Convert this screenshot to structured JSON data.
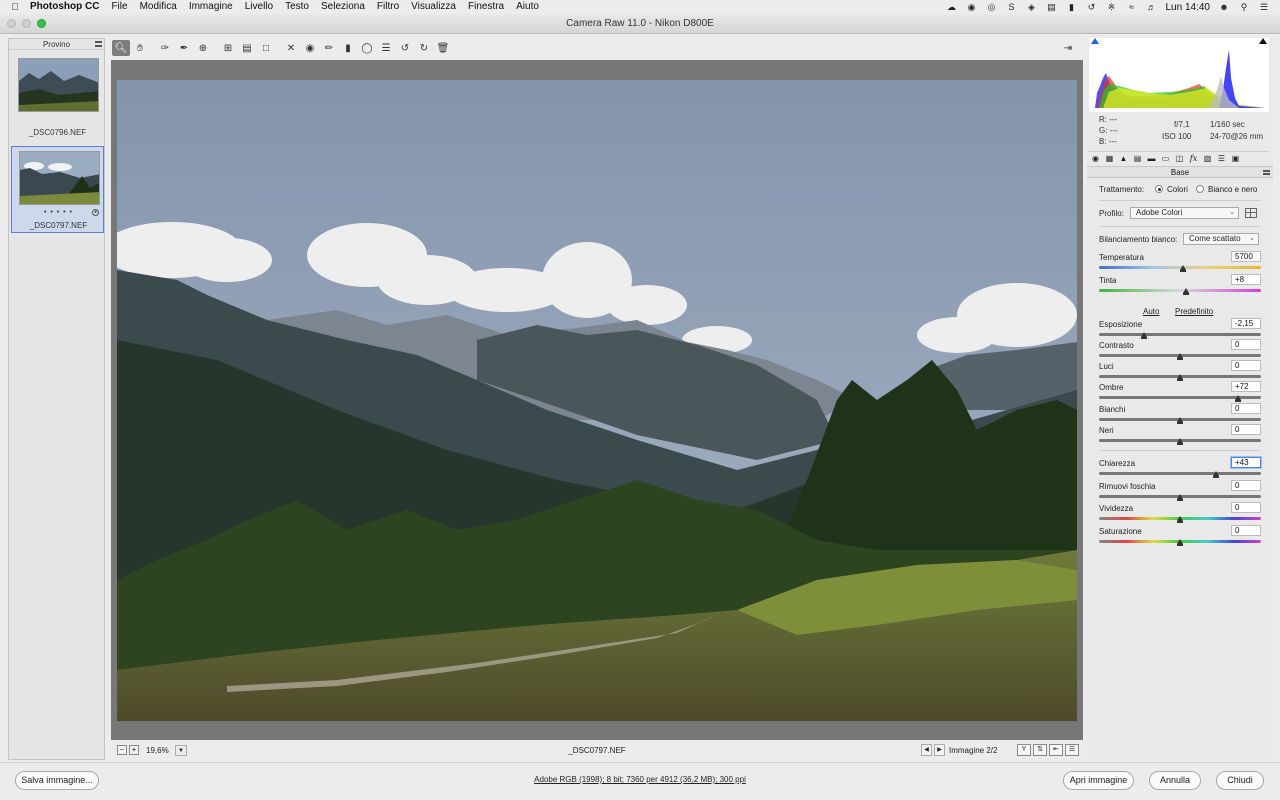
{
  "menubar": {
    "app_name": "Photoshop CC",
    "items": [
      "File",
      "Modifica",
      "Immagine",
      "Livello",
      "Testo",
      "Seleziona",
      "Filtro",
      "Visualizza",
      "Finestra",
      "Aiuto"
    ],
    "clock": "Lun 14:40"
  },
  "window": {
    "title": "Camera Raw 11.0  -  Nikon D800E"
  },
  "filmstrip": {
    "header": "Provino",
    "items": [
      {
        "name": "_DSC0796.NEF"
      },
      {
        "name": "_DSC0797.NEF",
        "rating": "• • • • •"
      }
    ]
  },
  "status": {
    "zoom": "19,6%",
    "filename": "_DSC0797.NEF",
    "image_count": "Immagine 2/2",
    "view_label": "Y"
  },
  "readout": {
    "r": "R:   ---",
    "g": "G:   ---",
    "b": "B:   ---",
    "aperture": "f/7,1",
    "shutter": "1/160 sec",
    "iso": "ISO 100",
    "lens": "24-70@26 mm"
  },
  "panel": {
    "title": "Base",
    "treatment_label": "Trattamento:",
    "treatment_color": "Colori",
    "treatment_bw": "Bianco e nero",
    "profile_label": "Profilo:",
    "profile_value": "Adobe Colori",
    "wb_label": "Bilanciamento bianco:",
    "wb_value": "Come scattato",
    "auto": "Auto",
    "default": "Predefinito",
    "controls": {
      "temperature": {
        "label": "Temperatura",
        "value": "5700",
        "position": 0.52
      },
      "tint": {
        "label": "Tinta",
        "value": "+8",
        "position": 0.54
      },
      "exposure": {
        "label": "Esposizione",
        "value": "-2,15",
        "position": 0.28
      },
      "contrast": {
        "label": "Contrasto",
        "value": "0",
        "position": 0.5
      },
      "highlights": {
        "label": "Luci",
        "value": "0",
        "position": 0.5
      },
      "shadows": {
        "label": "Ombre",
        "value": "+72",
        "position": 0.86
      },
      "whites": {
        "label": "Bianchi",
        "value": "0",
        "position": 0.5
      },
      "blacks": {
        "label": "Neri",
        "value": "0",
        "position": 0.5
      },
      "clarity": {
        "label": "Chiarezza",
        "value": "+43",
        "position": 0.72
      },
      "dehaze": {
        "label": "Rimuovi foschia",
        "value": "0",
        "position": 0.5
      },
      "vibrance": {
        "label": "Vividezza",
        "value": "0",
        "position": 0.5
      },
      "saturation": {
        "label": "Saturazione",
        "value": "0",
        "position": 0.5
      }
    }
  },
  "bottom": {
    "save": "Salva immagine...",
    "info": "Adobe RGB (1998); 8 bit; 7360 per 4912 (36,2 MB); 300 ppi",
    "open": "Apri immagine",
    "cancel": "Annulla",
    "close": "Chiudi"
  },
  "colors": {
    "accent": "#4a86e8",
    "selection": "#cdd8ea"
  }
}
